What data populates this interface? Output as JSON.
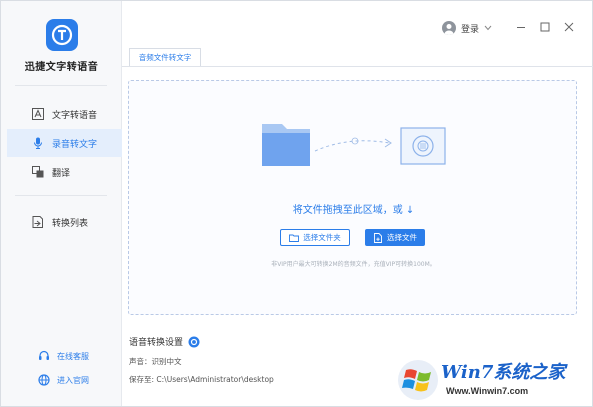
{
  "app": {
    "name": "迅捷文字转语音"
  },
  "nav": [
    {
      "label": "文字转语音",
      "icon": "text-to-speech-icon",
      "active": false
    },
    {
      "label": "录音转文字",
      "icon": "microphone-icon",
      "active": true
    },
    {
      "label": "翻译",
      "icon": "translate-icon",
      "active": false
    },
    {
      "label": "转换列表",
      "icon": "conversion-list-icon",
      "active": false
    }
  ],
  "footer": {
    "service": "在线客服",
    "website": "进入官网"
  },
  "titlebar": {
    "login": "登录"
  },
  "tab": {
    "label": "音频文件转文字"
  },
  "dropzone": {
    "text": "将文件拖拽至此区域，或 ↓",
    "select_folder": "选择文件夹",
    "select_file": "选择文件",
    "hint": "非VIP用户最大可转换2M的音频文件，充值VIP可转换100M。"
  },
  "settings": {
    "title": "语音转换设置",
    "voice": "声音：识别中文",
    "save_to": "保存至: C:\\Users\\Administrator\\desktop"
  },
  "watermark": {
    "brand": "Win7系统之家",
    "url": "Www.Winwin7.com"
  },
  "colors": {
    "accent": "#2b7de9",
    "active_bg": "#e4eefc",
    "sidebar_bg": "#f7f8fa"
  }
}
